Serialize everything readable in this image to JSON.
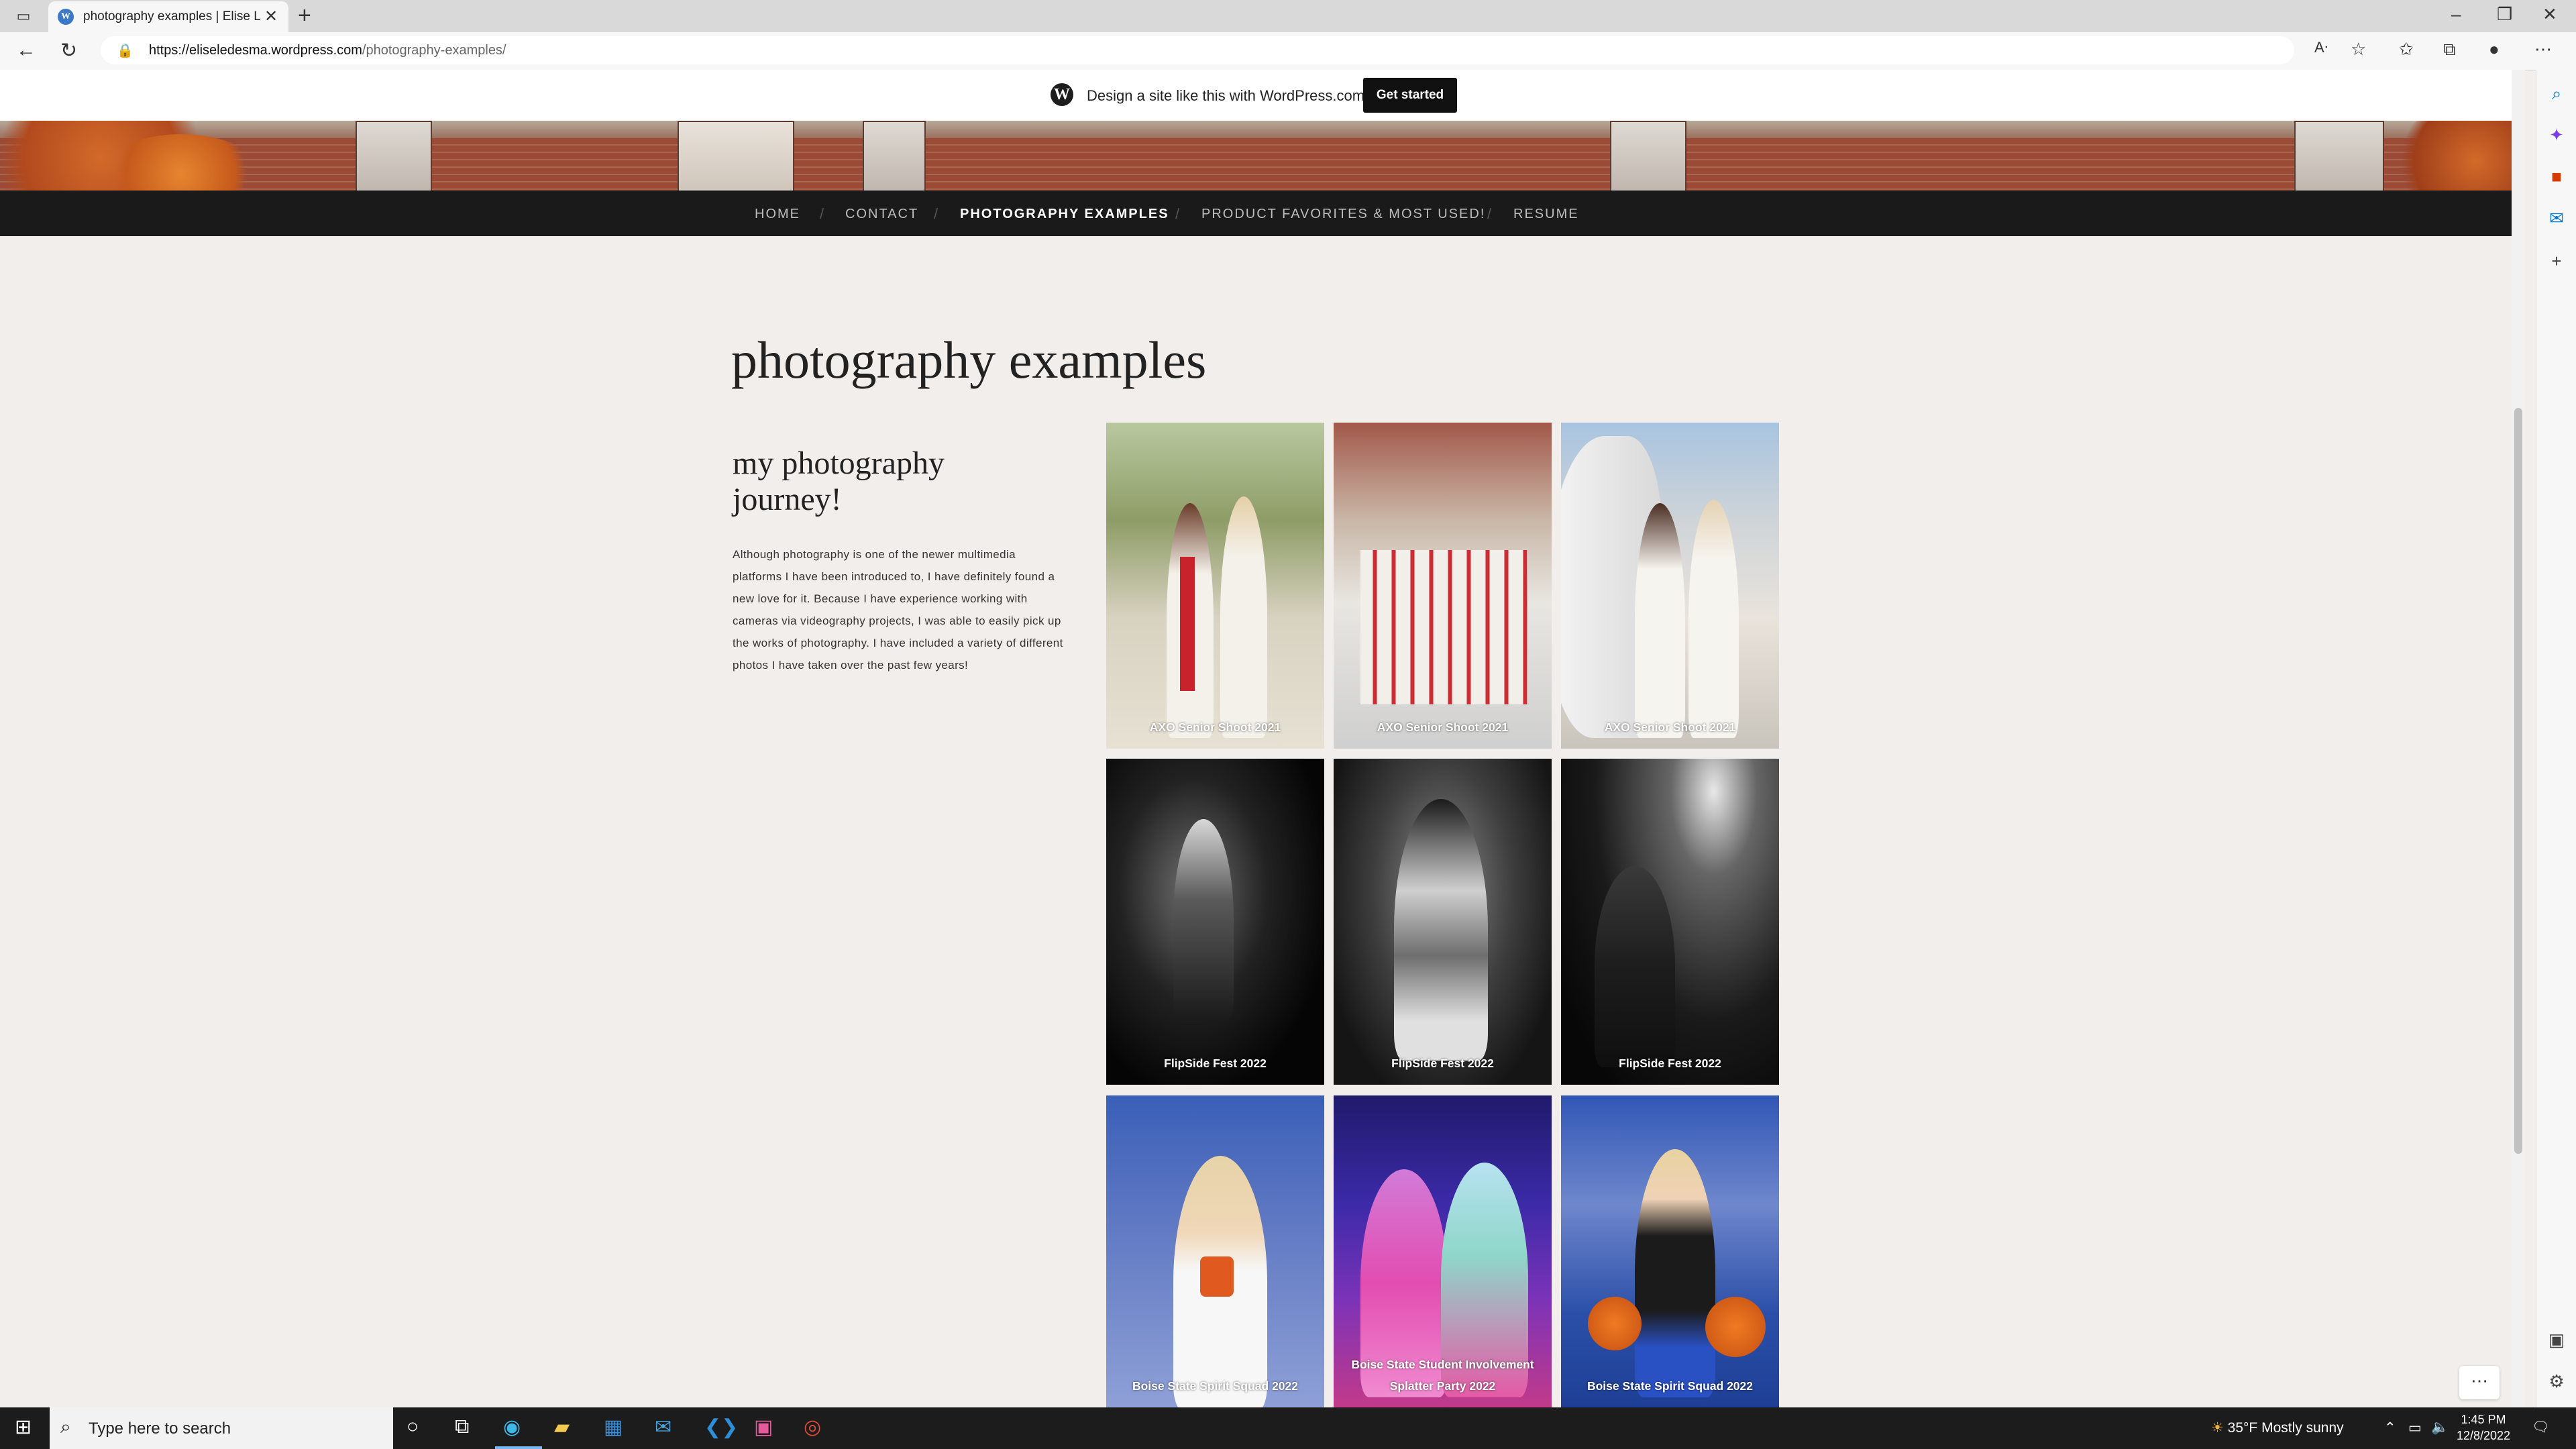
{
  "browser": {
    "tab_title": "photography examples | Elise Le",
    "new_tab": "+",
    "url_host": "https://eliseledesma.wordpress.com",
    "url_path": "/photography-examples/"
  },
  "wp_banner": {
    "text": "Design a site like this with WordPress.com",
    "button": "Get started"
  },
  "nav": {
    "items": [
      {
        "label": "HOME"
      },
      {
        "label": "CONTACT"
      },
      {
        "label": "PHOTOGRAPHY EXAMPLES"
      },
      {
        "label": "PRODUCT FAVORITES & MOST USED!"
      },
      {
        "label": "RESUME"
      }
    ],
    "separator": "/"
  },
  "page": {
    "title": "photography examples",
    "subtitle": "my photography journey!",
    "intro": "Although photography is one of the newer multimedia platforms I have been introduced to, I have definitely found a new love for it. Because I have experience working with cameras via videography projects, I was able to easily pick up the works of photography. I have included a variety of different photos I have taken over the past few years!"
  },
  "gallery": [
    {
      "caption": "AXO Senior Shoot 2021"
    },
    {
      "caption": "AXO Senior Shoot 2021"
    },
    {
      "caption": "AXO Senior Shoot 2021"
    },
    {
      "caption": "FlipSide Fest 2022"
    },
    {
      "caption": "FlipSide Fest 2022"
    },
    {
      "caption": "FlipSide Fest 2022"
    },
    {
      "caption": "Boise State Spirit Squad 2022"
    },
    {
      "caption": "Boise State Student Involvement Splatter Party 2022"
    },
    {
      "caption": "Boise State Spirit Squad 2022"
    }
  ],
  "taskbar": {
    "search_placeholder": "Type here to search",
    "weather": "35°F  Mostly sunny",
    "time": "1:45 PM",
    "date": "12/8/2022"
  },
  "colors": {
    "page_bg": "#f1eeeb",
    "nav_bg": "#1a1a1a",
    "wp_button": "#111111",
    "edge_accent": "#0078d4"
  }
}
